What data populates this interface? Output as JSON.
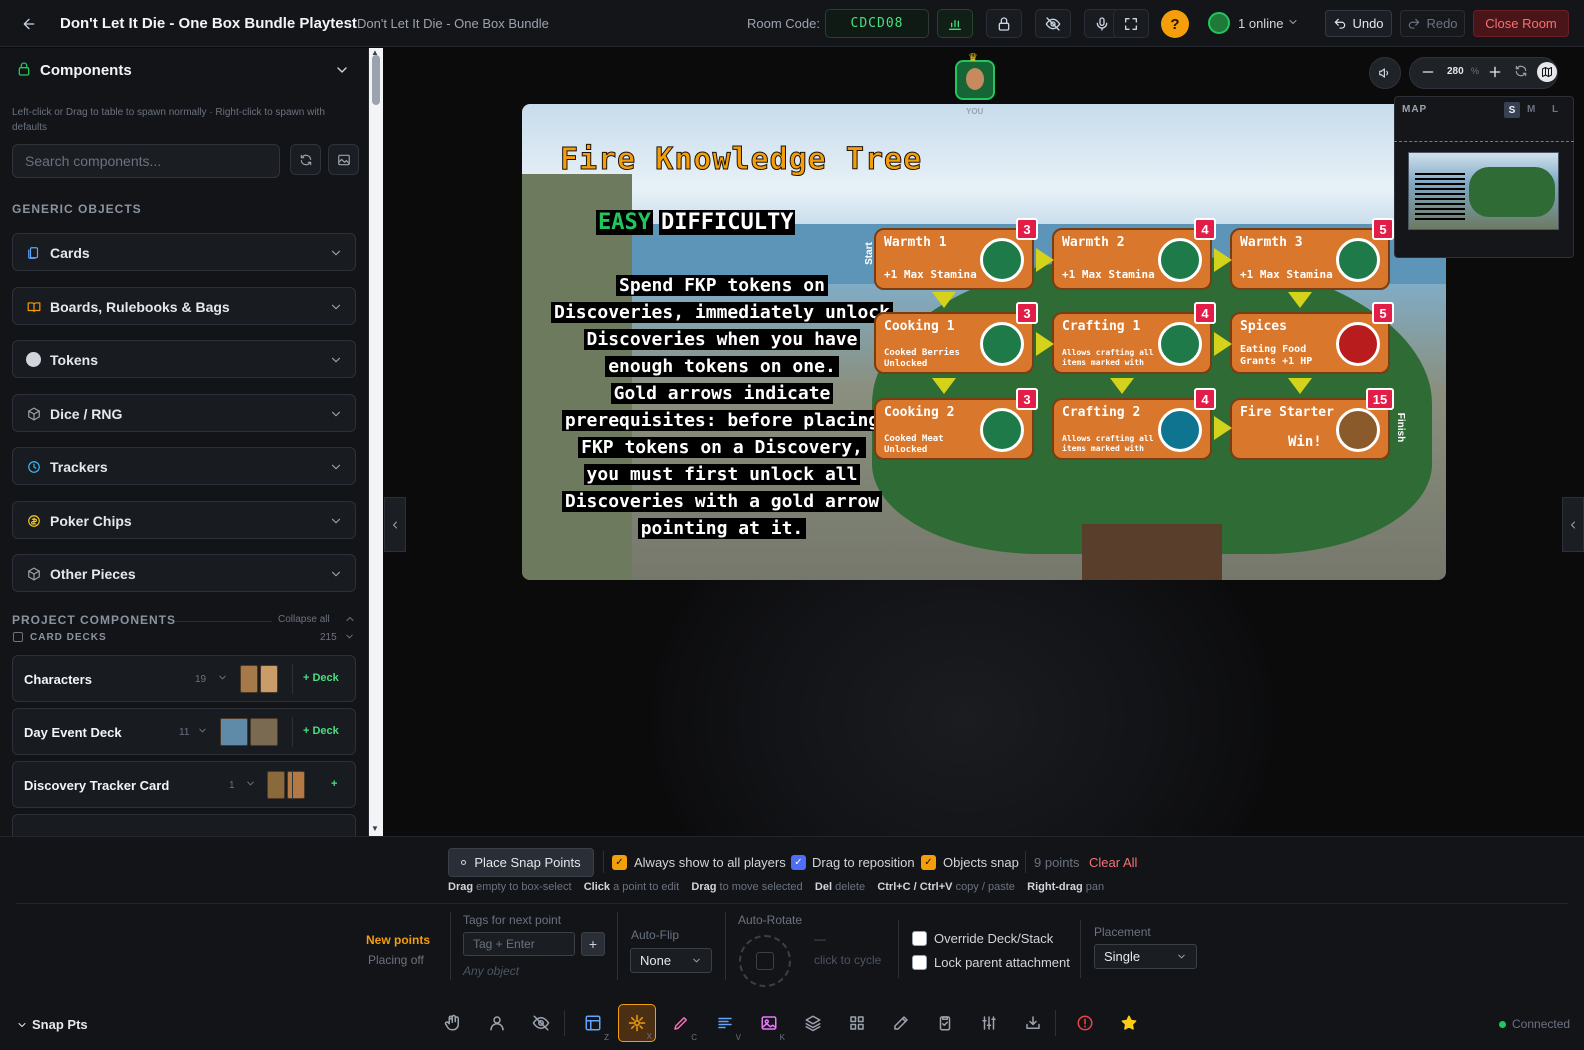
{
  "header": {
    "title": "Don't Let It Die - One Box Bundle Playtest",
    "separator": "·",
    "subtitle": "Don't Let It Die - One Box Bundle",
    "room_code_label": "Room Code:",
    "room_code": "CDCD08",
    "help": "?",
    "online": "1 online",
    "undo": "Undo",
    "redo": "Redo",
    "close_room": "Close Room"
  },
  "sidebar": {
    "title": "Components",
    "hint": "Left-click or Drag to table to spawn normally · Right-click to spawn with defaults",
    "search_placeholder": "Search components...",
    "generic_label": "GENERIC OBJECTS",
    "categories": [
      {
        "label": "Cards",
        "icon": "cards-icon",
        "color": "#60a5fa"
      },
      {
        "label": "Boards, Rulebooks & Bags",
        "icon": "book-icon",
        "color": "#f59e0b"
      },
      {
        "label": "Tokens",
        "icon": "token-icon",
        "color": "#d1d5db"
      },
      {
        "label": "Dice / RNG",
        "icon": "dice-icon",
        "color": "#9ca3af"
      },
      {
        "label": "Trackers",
        "icon": "clock-icon",
        "color": "#38bdf8"
      },
      {
        "label": "Poker Chips",
        "icon": "chip-icon",
        "color": "#facc15"
      },
      {
        "label": "Other Pieces",
        "icon": "cube-icon",
        "color": "#9ca3af"
      }
    ],
    "project_label": "PROJECT COMPONENTS",
    "collapse_all": "Collapse all",
    "card_decks_label": "CARD DECKS",
    "card_decks_count": "215",
    "decks": [
      {
        "name": "Characters",
        "count": "19",
        "add": "Deck"
      },
      {
        "name": "Day Event Deck",
        "count": "11",
        "add": "Deck"
      },
      {
        "name": "Discovery Tracker Card",
        "count": "1",
        "add": ""
      }
    ]
  },
  "board": {
    "title": "Fire Knowledge Tree",
    "difficulty_easy": "EASY",
    "difficulty_word": "DIFFICULTY",
    "description": [
      "Spend FKP tokens on",
      "Discoveries, immediately unlock",
      "Discoveries when you have",
      "enough tokens on one.",
      "Gold arrows indicate",
      "prerequisites: before placing",
      "FKP tokens on a Discovery,",
      "you must first unlock all",
      "Discoveries with a gold arrow",
      "pointing at it."
    ],
    "nodes": [
      {
        "label": "Warmth 1",
        "sub": "+1 Max Stamina",
        "points": "3"
      },
      {
        "label": "Warmth 2",
        "sub": "+1 Max Stamina",
        "points": "4"
      },
      {
        "label": "Warmth 3",
        "sub": "+1 Max Stamina",
        "points": "5"
      },
      {
        "label": "Cooking 1",
        "sub": "Cooked Berries Unlocked",
        "points": "3"
      },
      {
        "label": "Crafting 1",
        "sub": "Allows crafting all items marked with",
        "points": "4"
      },
      {
        "label": "Spices",
        "sub": "Eating Food Grants +1 HP",
        "points": "5"
      },
      {
        "label": "Cooking 2",
        "sub": "Cooked Meat Unlocked",
        "points": "3"
      },
      {
        "label": "Crafting 2",
        "sub": "Allows crafting all items marked with",
        "points": "4"
      },
      {
        "label": "Fire Starter",
        "sub": "Win!",
        "points": "15"
      }
    ],
    "start_label": "Start",
    "finish_label": "Finish"
  },
  "player": {
    "label": "YOU"
  },
  "zoom": {
    "value": "280",
    "unit": "%"
  },
  "minimap": {
    "label": "MAP",
    "sizes": [
      "S",
      "M",
      "L"
    ]
  },
  "snap": {
    "place_button": "Place Snap Points",
    "always_show": "Always show to all players",
    "drag_reposition": "Drag to reposition",
    "objects_snap": "Objects snap",
    "points_count": "9 points",
    "clear_all": "Clear All",
    "hints": [
      {
        "key": "Drag",
        "text": "empty to box-select"
      },
      {
        "key": "Click",
        "text": "a point to edit"
      },
      {
        "key": "Drag",
        "text": "to move selected"
      },
      {
        "key": "Del",
        "text": "delete"
      },
      {
        "key": "Ctrl+C / Ctrl+V",
        "text": "copy / paste"
      },
      {
        "key": "Right-drag",
        "text": "pan"
      }
    ],
    "new_points_title": "New points",
    "new_points_sub": "Placing off",
    "tags_label": "Tags for next point",
    "tag_placeholder": "Tag + Enter",
    "any_object": "Any object",
    "autoflip_label": "Auto-Flip",
    "autoflip_value": "None",
    "autorotate_label": "Auto-Rotate",
    "autorotate_dash": "—",
    "autorotate_hint": "click to cycle",
    "override": "Override Deck/Stack",
    "lock_parent": "Lock parent attachment",
    "placement_label": "Placement",
    "placement_value": "Single",
    "panel_name": "Snap Pts"
  },
  "toolbar": {
    "tools": [
      {
        "name": "hand-tool",
        "key": ""
      },
      {
        "name": "user-tool",
        "key": ""
      },
      {
        "name": "hide-tool",
        "key": ""
      },
      {
        "name": "layout-tool",
        "key": "Z"
      },
      {
        "name": "snap-tool",
        "key": "X"
      },
      {
        "name": "draw-tool",
        "key": "C"
      },
      {
        "name": "text-tool",
        "key": "V"
      },
      {
        "name": "image-tool",
        "key": "K"
      },
      {
        "name": "layers-tool",
        "key": ""
      },
      {
        "name": "grid-tool",
        "key": ""
      },
      {
        "name": "edit-tool",
        "key": ""
      },
      {
        "name": "clipboard-tool",
        "key": ""
      },
      {
        "name": "sliders-tool",
        "key": ""
      },
      {
        "name": "download-tool",
        "key": ""
      },
      {
        "name": "alert-tool",
        "key": ""
      },
      {
        "name": "star-tool",
        "key": ""
      }
    ],
    "connected": "Connected"
  }
}
